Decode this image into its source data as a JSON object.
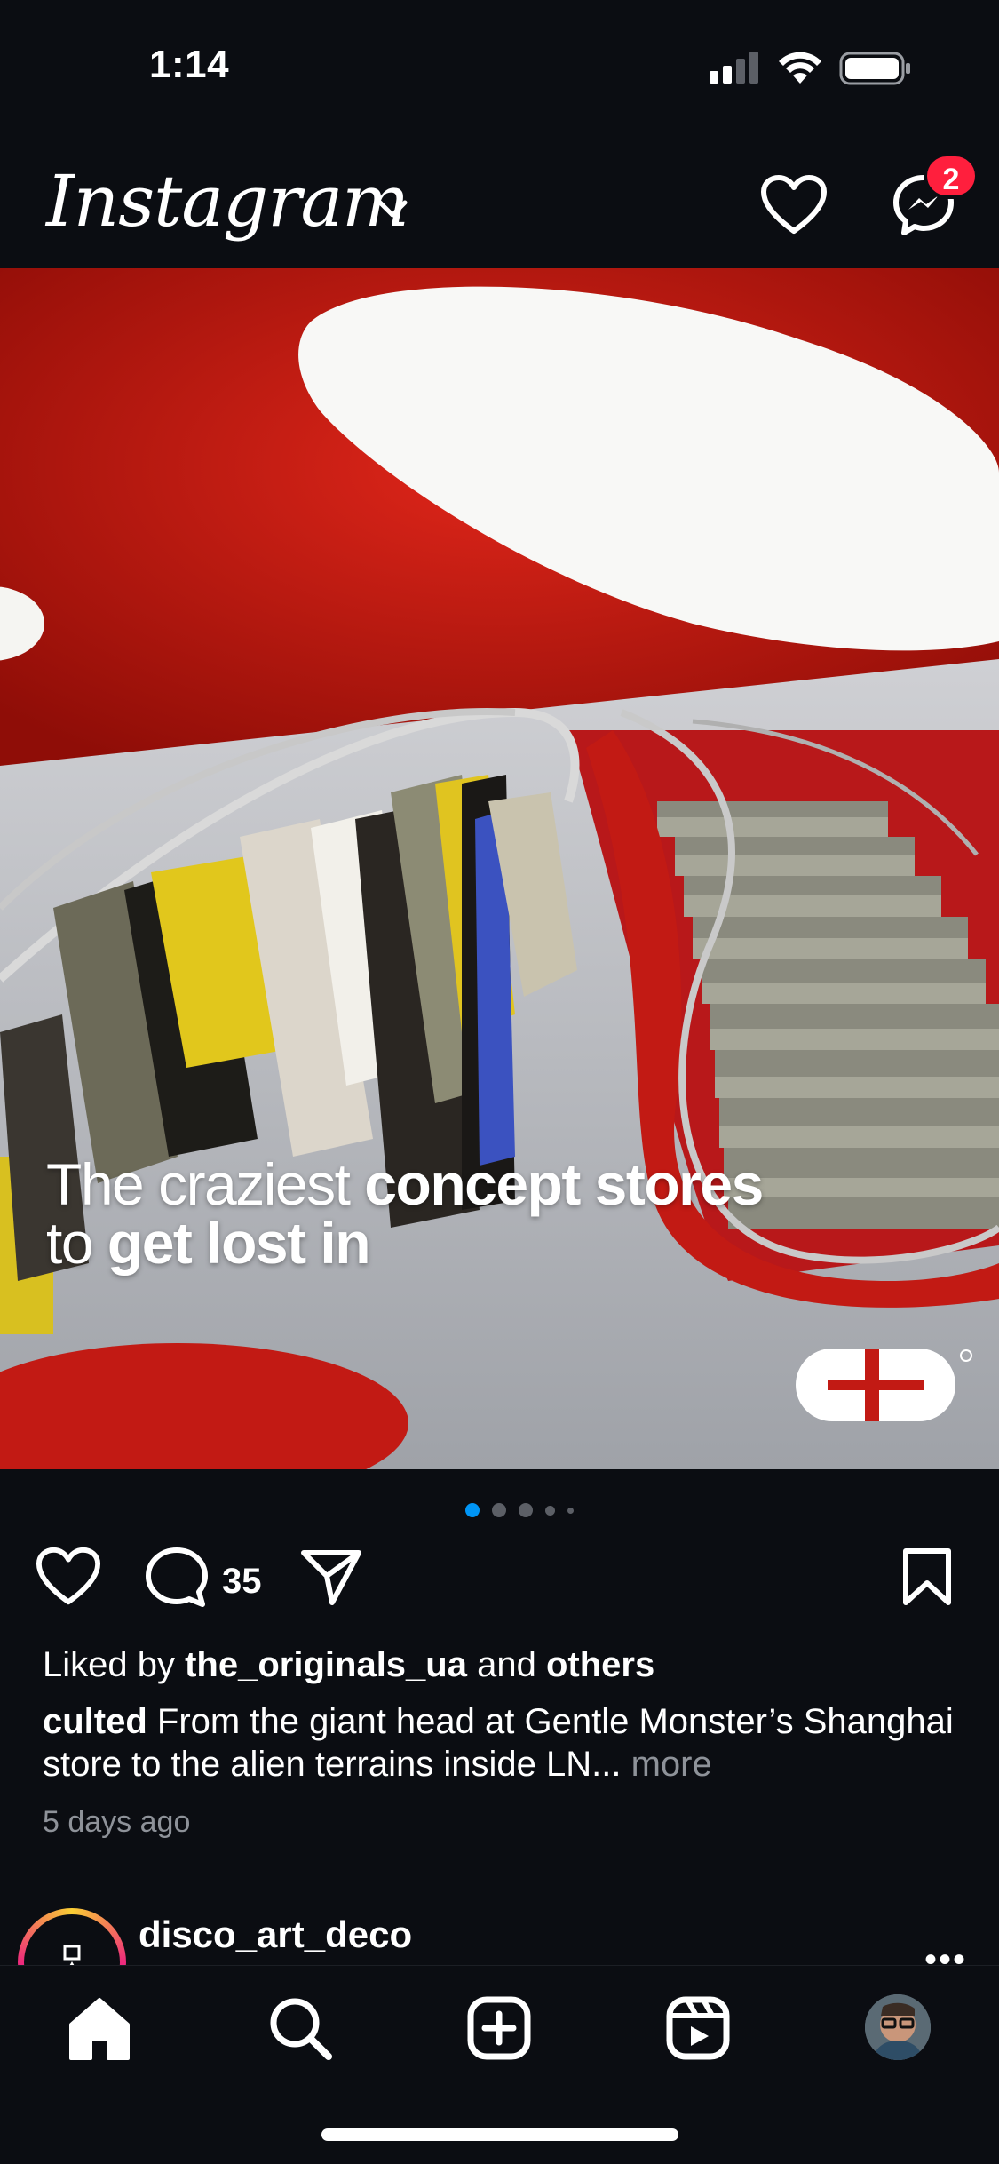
{
  "status_bar": {
    "time": "1:14"
  },
  "header": {
    "app_name": "Instagram",
    "notifications_badge": "2"
  },
  "post": {
    "overlay_text": {
      "line1_light": "The craziest ",
      "line1_bold": "concept stores",
      "line2_light": "to ",
      "line2_bold": "get lost in"
    },
    "logo_mark": "culted-logo",
    "carousel": {
      "count": 5,
      "active_index": 0
    },
    "comment_count": "35",
    "liked_by_prefix": "Liked by ",
    "liked_by_user": "the_originals_ua",
    "liked_by_joiner": " and ",
    "liked_by_others": "others",
    "caption_user": "culted",
    "caption_text": " From the giant head at Gentle Monster’s Shanghai store to the alien terrains inside LN...",
    "caption_more": " more",
    "timestamp": "5 days ago"
  },
  "next_post": {
    "username": "disco_art_deco",
    "menu": "•••"
  },
  "nav": {
    "items": [
      "home-icon",
      "search-icon",
      "create-icon",
      "reels-icon",
      "profile-avatar"
    ]
  },
  "colors": {
    "background": "#0b0d12",
    "accent_blue": "#0095f6",
    "badge_red": "#ff1f3d",
    "muted_text": "#8e9299"
  }
}
